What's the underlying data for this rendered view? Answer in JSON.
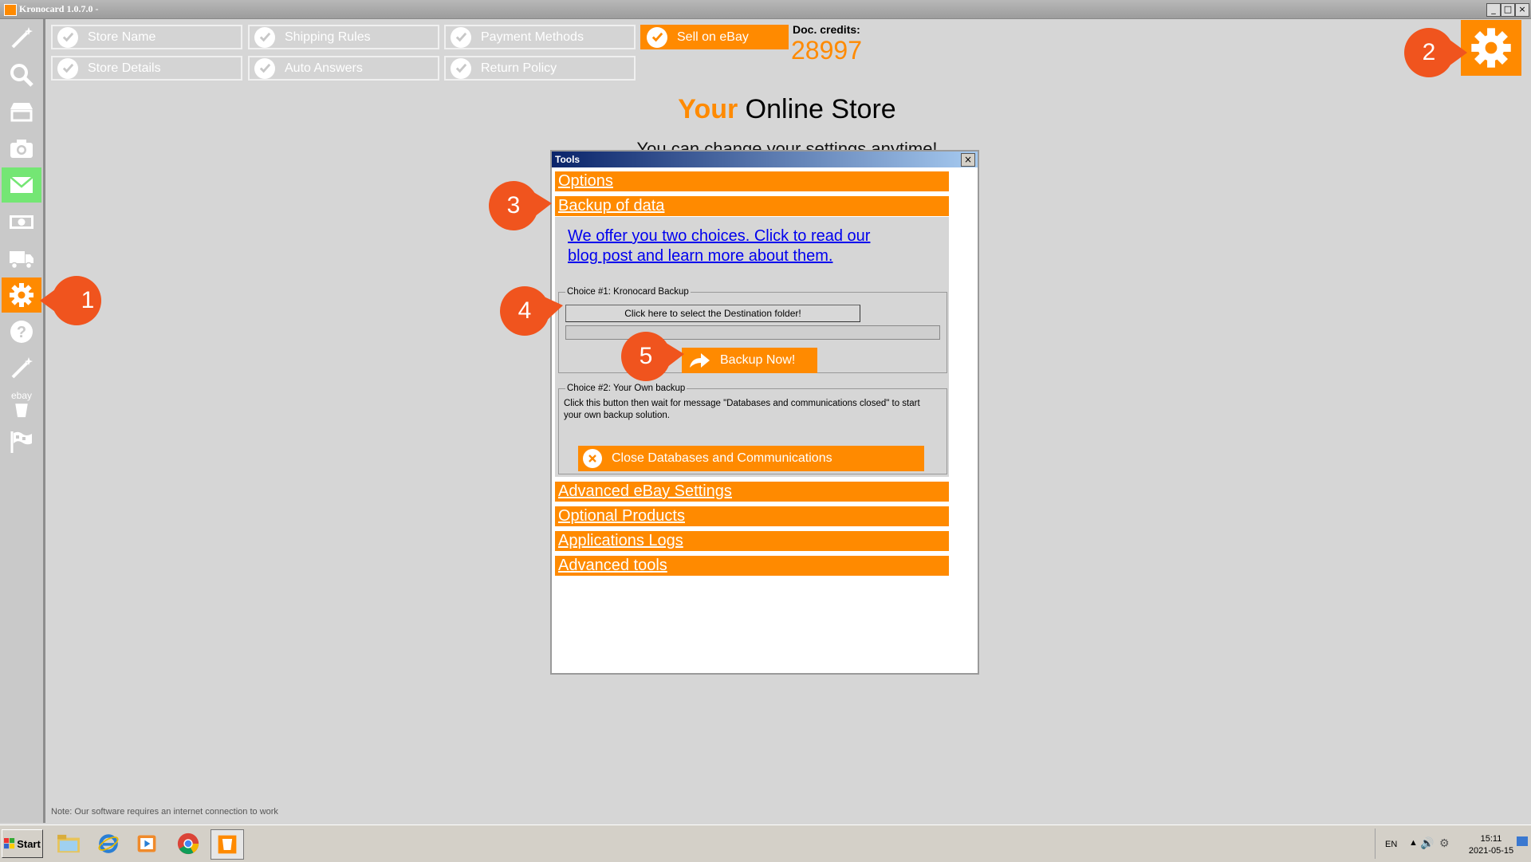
{
  "window": {
    "title": "Kronocard 1.0.7.0 -",
    "buttons": [
      "_",
      "□",
      "×"
    ]
  },
  "sidebar": {
    "items": [
      {
        "icon": "magic-wand-icon"
      },
      {
        "icon": "search-icon"
      },
      {
        "icon": "store-icon"
      },
      {
        "icon": "camera-icon"
      },
      {
        "icon": "envelope-icon"
      },
      {
        "icon": "money-icon"
      },
      {
        "icon": "truck-icon"
      },
      {
        "icon": "gear-icon"
      },
      {
        "icon": "help-icon"
      },
      {
        "icon": "magic-wand-icon"
      },
      {
        "icon": "ebay-icon",
        "label": "ebay"
      },
      {
        "icon": "flags-icon"
      }
    ]
  },
  "setup_buttons": {
    "store_name": "Store Name",
    "shipping_rules": "Shipping Rules",
    "payment_methods": "Payment Methods",
    "sell_on_ebay": "Sell on eBay",
    "store_details": "Store Details",
    "auto_answers": "Auto Answers",
    "return_policy": "Return Policy"
  },
  "credits": {
    "label": "Doc. credits:",
    "value": "28997"
  },
  "heading": {
    "your": "Your",
    "rest": " Online Store",
    "subtitle": "You can change your settings anytime!"
  },
  "tools_dialog": {
    "title": "Tools",
    "close": "×",
    "sections": {
      "options": "Options",
      "backup": "Backup of data",
      "advanced_ebay": "Advanced eBay Settings",
      "optional_products": "Optional Products",
      "app_logs": "Applications Logs",
      "advanced_tools": "Advanced tools"
    },
    "blog_link": "We offer you two choices. Click to read our blog post and learn more about them.",
    "choice1": {
      "legend": "Choice #1: Kronocard Backup",
      "dest_button": "Click here to select the Destination folder!",
      "dest_path": "",
      "backup_now": "Backup Now!"
    },
    "choice2": {
      "legend": "Choice #2: Your Own backup",
      "description": "Click this button then wait for message \"Databases and communications closed\" to start your own backup solution.",
      "close_button": "Close Databases and Communications"
    }
  },
  "callouts": [
    "1",
    "2",
    "3",
    "4",
    "5"
  ],
  "note": "Note: Our software requires an internet connection to work",
  "taskbar": {
    "start": "Start",
    "apps": [
      "file-explorer-icon",
      "internet-explorer-icon",
      "media-player-icon",
      "chrome-icon",
      "kronocard-icon"
    ],
    "language": "EN",
    "time": "15:11",
    "date": "2021-05-15"
  },
  "colors": {
    "accent": "#ff8a00",
    "callout": "#f0541e",
    "link": "#0000ee"
  }
}
